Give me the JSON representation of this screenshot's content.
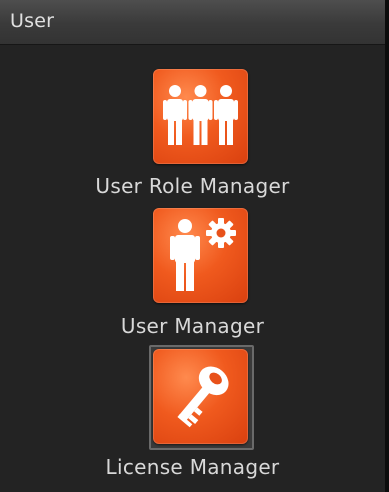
{
  "header": {
    "title": "User"
  },
  "items": [
    {
      "label": "User Role Manager",
      "icon": "user-role-group-icon",
      "selected": false
    },
    {
      "label": "User Manager",
      "icon": "user-gear-icon",
      "selected": false
    },
    {
      "label": "License Manager",
      "icon": "key-icon",
      "selected": true
    }
  ],
  "colors": {
    "panel_bg": "#232323",
    "header_bg": "#3e3e3e",
    "tile_orange": "#f05a1e",
    "label_text": "#d8d8d8"
  }
}
